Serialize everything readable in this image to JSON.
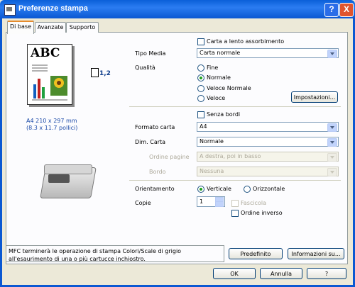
{
  "window": {
    "title": "Preferenze stampa",
    "help_label": "?",
    "close_label": "X"
  },
  "tabs": [
    {
      "label": "Di base",
      "active": true
    },
    {
      "label": "Avanzate"
    },
    {
      "label": "Supporto"
    }
  ],
  "preview": {
    "doc_text": "ABC",
    "copies_badge": "1,2",
    "paper_line1": "A4 210 x 297 mm",
    "paper_line2": "(8.3 x 11.7 pollici)"
  },
  "carta_lento": {
    "label": "Carta a lento assorbimento",
    "checked": false
  },
  "tipo_media": {
    "label": "Tipo Media",
    "value": "Carta normale"
  },
  "qualita": {
    "label": "Qualità",
    "options": [
      "Fine",
      "Normale",
      "Veloce Normale",
      "Veloce"
    ],
    "selected": "Normale"
  },
  "impostazioni_button": "Impostazioni...",
  "senza_bordi": {
    "label": "Senza bordi",
    "checked": false
  },
  "formato_carta": {
    "label": "Formato carta",
    "value": "A4"
  },
  "dim_carta": {
    "label": "Dim. Carta",
    "value": "Normale"
  },
  "ordine_pagine": {
    "label": "Ordine pagine",
    "value": "A destra, poi in basso"
  },
  "bordo": {
    "label": "Bordo",
    "value": "Nessuna"
  },
  "orientamento": {
    "label": "Orientamento",
    "options": [
      "Verticale",
      "Orizzontale"
    ],
    "selected": "Verticale"
  },
  "copie": {
    "label": "Copie",
    "value": "1",
    "fascicola_label": "Fascicola",
    "ordine_inverso_label": "Ordine inverso"
  },
  "info_text": "MFC terminerà le operazione di stampa Colori/Scale di grigio all'esaurimento di una o più cartucce inchiostro.",
  "buttons": {
    "predefinito": "Predefinito",
    "informazioni": "Informazioni su...",
    "ok": "OK",
    "annulla": "Annulla",
    "help": "?"
  },
  "colors": {
    "title_blue": "#0a5fd8",
    "face": "#ece9d8",
    "accent_orange": "#e68b2c",
    "radio_green": "#21a121"
  }
}
